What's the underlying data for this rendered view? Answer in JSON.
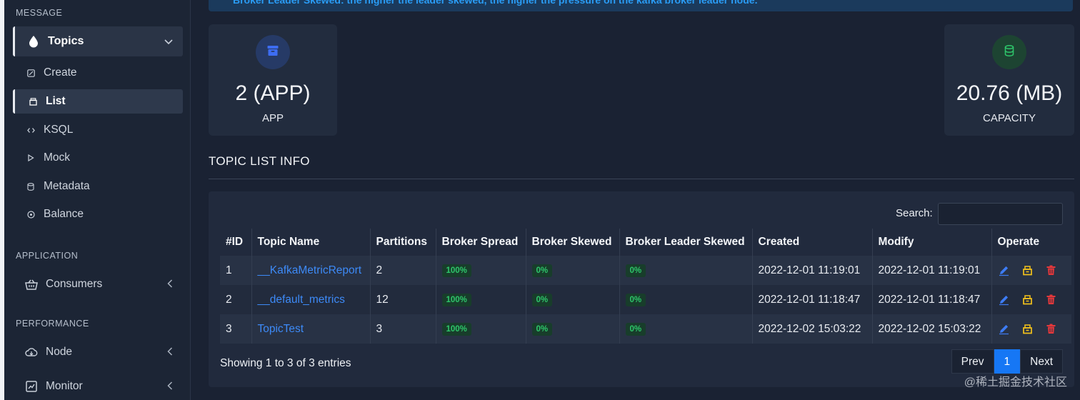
{
  "sidebar": {
    "sections": [
      {
        "title": "MESSAGE"
      },
      {
        "title": "APPLICATION"
      },
      {
        "title": "PERFORMANCE"
      }
    ],
    "topics": {
      "label": "Topics",
      "icon": "drop-icon"
    },
    "topic_items": [
      {
        "label": "Create",
        "icon": "edit-square-icon"
      },
      {
        "label": "List",
        "icon": "archive-icon"
      },
      {
        "label": "KSQL",
        "icon": "code-icon"
      },
      {
        "label": "Mock",
        "icon": "play-icon"
      },
      {
        "label": "Metadata",
        "icon": "database-icon"
      },
      {
        "label": "Balance",
        "icon": "balance-icon"
      }
    ],
    "consumers": {
      "label": "Consumers",
      "icon": "basket-icon"
    },
    "node": {
      "label": "Node",
      "icon": "cloud-download-icon"
    },
    "monitor": {
      "label": "Monitor",
      "icon": "chart-box-icon"
    }
  },
  "alert": {
    "text": "Broker Leader Skewed: the higher the leader skewed, the higher the pressure on the kafka broker leader node."
  },
  "cards": {
    "app": {
      "value": "2 (APP)",
      "label": "APP",
      "icon": "archive-icon",
      "color": "#3d6df2"
    },
    "capacity": {
      "value": "20.76 (MB)",
      "label": "CAPACITY",
      "icon": "database-icon",
      "color": "#2ec76b"
    }
  },
  "section_title": "TOPIC LIST INFO",
  "search": {
    "label": "Search:",
    "value": ""
  },
  "table": {
    "headers": [
      "#ID",
      "Topic Name",
      "Partitions",
      "Broker Spread",
      "Broker Skewed",
      "Broker Leader Skewed",
      "Created",
      "Modify",
      "Operate"
    ],
    "rows": [
      {
        "id": "1",
        "name": "__KafkaMetricReport",
        "partitions": "2",
        "spread": "100%",
        "skewed": "0%",
        "leader_skewed": "0%",
        "created": "2022-12-01 11:19:01",
        "modify": "2022-12-01 11:19:01"
      },
      {
        "id": "2",
        "name": "__default_metrics",
        "partitions": "12",
        "spread": "100%",
        "skewed": "0%",
        "leader_skewed": "0%",
        "created": "2022-12-01 11:18:47",
        "modify": "2022-12-01 11:18:47"
      },
      {
        "id": "3",
        "name": "TopicTest",
        "partitions": "3",
        "spread": "100%",
        "skewed": "0%",
        "leader_skewed": "0%",
        "created": "2022-12-02 15:03:22",
        "modify": "2022-12-02 15:03:22"
      }
    ]
  },
  "footer": {
    "showing": "Showing 1 to 3 of 3 entries"
  },
  "pagination": {
    "prev": "Prev",
    "current": "1",
    "next": "Next"
  },
  "watermark": "@稀土掘金技术社区"
}
